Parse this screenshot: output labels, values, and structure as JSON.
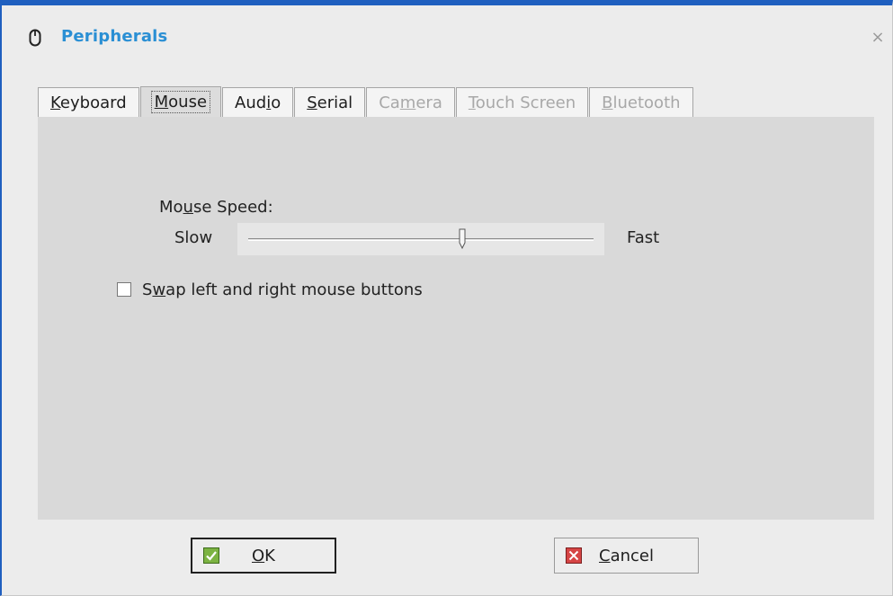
{
  "window": {
    "title": "Peripherals",
    "title_icon": "mouse-icon",
    "close_icon": "close-icon",
    "close_glyph": "×",
    "accent_color": "#2a8fd4",
    "border_color": "#1f5fbf"
  },
  "tabs": [
    {
      "pre": "",
      "mn": "K",
      "post": "eyboard",
      "state": "normal"
    },
    {
      "pre": "",
      "mn": "M",
      "post": "ouse",
      "state": "active"
    },
    {
      "pre": "Aud",
      "mn": "i",
      "post": "o",
      "state": "normal"
    },
    {
      "pre": "",
      "mn": "S",
      "post": "erial",
      "state": "normal"
    },
    {
      "pre": "Ca",
      "mn": "m",
      "post": "era",
      "state": "disabled"
    },
    {
      "pre": "",
      "mn": "T",
      "post": "ouch Screen",
      "state": "disabled"
    },
    {
      "pre": "",
      "mn": "B",
      "post": "luetooth",
      "state": "disabled"
    }
  ],
  "mouse": {
    "speed_label": {
      "pre": "Mo",
      "mn": "u",
      "post": "se Speed:"
    },
    "slow_label": "Slow",
    "fast_label": "Fast",
    "speed_value": 0.62,
    "swap_label": {
      "pre": "S",
      "mn": "w",
      "post": "ap left and right mouse buttons"
    },
    "swap_checked": false
  },
  "buttons": {
    "ok": {
      "pre": "",
      "mn": "O",
      "post": "K",
      "icon": "check-icon",
      "color": "#7cb342"
    },
    "cancel": {
      "pre": "",
      "mn": "C",
      "post": "ancel",
      "icon": "x-icon",
      "color": "#d64545"
    }
  }
}
